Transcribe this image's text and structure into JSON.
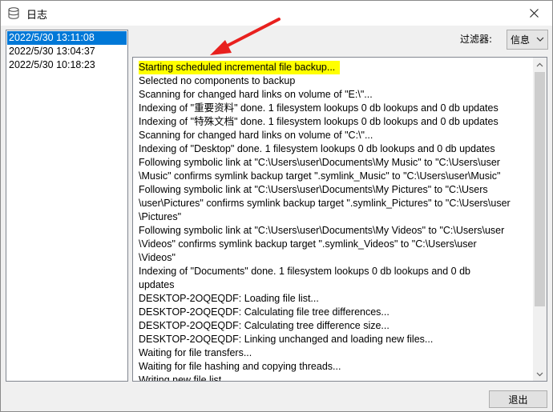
{
  "window": {
    "title": "日志",
    "close_icon": "close-icon"
  },
  "sessions": [
    {
      "label": "2022/5/30 13:11:08",
      "selected": true
    },
    {
      "label": "2022/5/30 13:04:37",
      "selected": false
    },
    {
      "label": "2022/5/30 10:18:23",
      "selected": false
    }
  ],
  "filter": {
    "label": "过滤器:",
    "value": "信息"
  },
  "log": {
    "lines": [
      "Starting scheduled incremental file backup...",
      "Selected no components to backup",
      "Scanning for changed hard links on volume of \"E:\\\"...",
      "Indexing of \"重要资料\" done. 1 filesystem lookups 0 db lookups and 0 db updates",
      "Indexing of \"特殊文档\" done. 1 filesystem lookups 0 db lookups and 0 db updates",
      "Scanning for changed hard links on volume of \"C:\\\"...",
      "Indexing of \"Desktop\" done. 1 filesystem lookups 0 db lookups and 0 db updates",
      "Following symbolic link at \"C:\\Users\\user\\Documents\\My Music\" to \"C:\\Users\\user\n\\Music\" confirms symlink backup target \".symlink_Music\" to \"C:\\Users\\user\\Music\"",
      "Following symbolic link at \"C:\\Users\\user\\Documents\\My Pictures\" to \"C:\\Users\n\\user\\Pictures\" confirms symlink backup target \".symlink_Pictures\" to \"C:\\Users\\user\n\\Pictures\"",
      "Following symbolic link at \"C:\\Users\\user\\Documents\\My Videos\" to \"C:\\Users\\user\n\\Videos\" confirms symlink backup target \".symlink_Videos\" to \"C:\\Users\\user\n\\Videos\"",
      "Indexing of \"Documents\" done. 1 filesystem lookups 0 db lookups and 0 db\nupdates",
      "DESKTOP-2OQEQDF: Loading file list...",
      "DESKTOP-2OQEQDF: Calculating file tree differences...",
      "DESKTOP-2OQEQDF: Calculating tree difference size...",
      "DESKTOP-2OQEQDF: Linking unchanged and loading new files...",
      "Waiting for file transfers...",
      "Waiting for file hashing and copying threads...",
      "Writing new file list..."
    ],
    "highlight_color": "#ffff00"
  },
  "footer": {
    "exit_label": "退出"
  },
  "colors": {
    "selection": "#0078d7",
    "annotation_arrow": "#e8201e"
  }
}
